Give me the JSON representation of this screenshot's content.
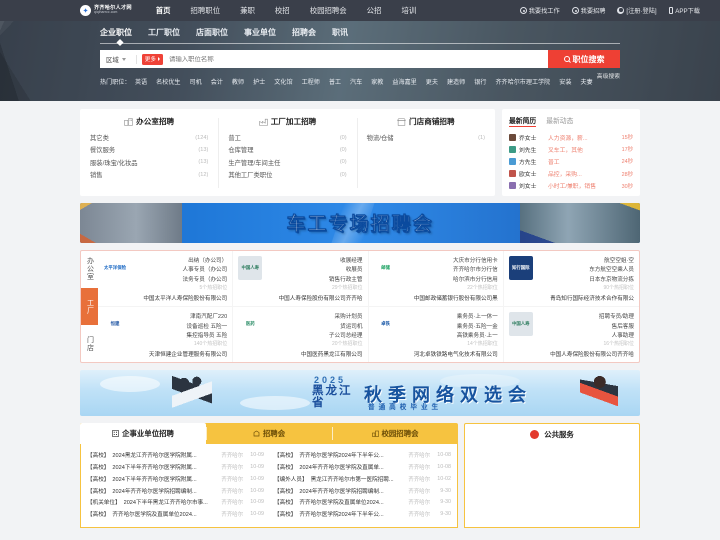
{
  "site": {
    "logo_cn": "齐齐哈尔人才网",
    "logo_en": "qiqiharrcc.com",
    "logo_glyph": "✦"
  },
  "topnav": {
    "items": [
      {
        "label": "首页",
        "active": true
      },
      {
        "label": "招聘职位",
        "active": false
      },
      {
        "label": "兼职",
        "active": false
      },
      {
        "label": "校招",
        "active": false
      },
      {
        "label": "校园招聘会",
        "active": false
      },
      {
        "label": "公招",
        "active": false
      },
      {
        "label": "培训",
        "active": false
      }
    ],
    "right": [
      {
        "label": "我要找工作",
        "icon": "compass-icon"
      },
      {
        "label": "我要招聘",
        "icon": "compass-icon"
      },
      {
        "label": "[注册·登陆]",
        "icon": "user-icon"
      },
      {
        "label": "APP下载",
        "icon": "phone-icon"
      }
    ]
  },
  "subnav": {
    "items": [
      {
        "label": "企业职位",
        "active": true
      },
      {
        "label": "工厂职位",
        "active": false
      },
      {
        "label": "店面职位",
        "active": false
      },
      {
        "label": "事业单位",
        "active": false
      },
      {
        "label": "招聘会",
        "active": false
      },
      {
        "label": "职讯",
        "active": false
      }
    ]
  },
  "search": {
    "region_label": "区域",
    "more_label": "更多",
    "placeholder": "请输入职位名称",
    "button_label": "职位搜索",
    "advanced_label": "高级搜索"
  },
  "hot": {
    "label": "热门职位：",
    "tags": [
      "英语",
      "名校优生",
      "司机",
      "会计",
      "教师",
      "护士",
      "文化馆",
      "工程师",
      "普工",
      "汽车",
      "家教",
      "益海嘉里",
      "更夫",
      "建造师",
      "银行",
      "齐齐哈尔市理工学院",
      "安装",
      "夫妻"
    ]
  },
  "categories": [
    {
      "title": "办公室招聘",
      "icon": "office-building-icon",
      "items": [
        {
          "name": "其它类",
          "count": "(124)"
        },
        {
          "name": "餐饮服务",
          "count": "(13)"
        },
        {
          "name": "服装/珠宝/化妆品",
          "count": "(13)"
        },
        {
          "name": "销售",
          "count": "(12)"
        }
      ]
    },
    {
      "title": "工厂加工招聘",
      "icon": "factory-icon",
      "items": [
        {
          "name": "普工",
          "count": "(0)"
        },
        {
          "name": "仓库管理",
          "count": "(0)"
        },
        {
          "name": "生产管理/车间主任",
          "count": "(0)"
        },
        {
          "name": "其他工厂类职位",
          "count": "(0)"
        }
      ]
    },
    {
      "title": "门店商铺招聘",
      "icon": "shop-icon",
      "items": [
        {
          "name": "物流/仓储",
          "count": "(1)"
        }
      ]
    }
  ],
  "news_panel": {
    "tabs": [
      {
        "label": "最新简历",
        "active": true
      },
      {
        "label": "最新动态",
        "active": false
      }
    ],
    "rows": [
      {
        "name": "乔女士",
        "job": "人力资源，薪...",
        "time": "15秒",
        "color": "#6b4a3a"
      },
      {
        "name": "刘先生",
        "job": "叉车工，其他",
        "time": "17秒",
        "color": "#3c9b86"
      },
      {
        "name": "方先生",
        "job": "普工",
        "time": "24秒",
        "color": "#4a9bd4"
      },
      {
        "name": "欧女士",
        "job": "品控，采购...",
        "time": "28秒",
        "color": "#c0534a"
      },
      {
        "name": "刘女士",
        "job": "小时工/兼职，销售",
        "time": "30秒",
        "color": "#8a6fb0"
      }
    ]
  },
  "banner1": {
    "title": "车工专场招聘会"
  },
  "company_grid": {
    "vtabs": [
      {
        "label": "办公室",
        "active": false
      },
      {
        "label": "工厂",
        "active": true
      },
      {
        "label": "门店",
        "active": false
      }
    ],
    "cells": [
      {
        "logo_text": "太平洋保险",
        "logo_bg": "#ffffff",
        "logo_fg": "#1a68c4",
        "jobs": [
          "出纳（办公司）",
          "人事专员（办公司",
          "法务专员（办公司"
        ],
        "count": "5个热招职位",
        "company": "中国太平洋人寿保险股份有限公司"
      },
      {
        "logo_text": "中国人寿",
        "logo_bg": "#dfe5ea",
        "logo_fg": "#2e7d5f",
        "jobs": [
          "收展经理",
          "收展员",
          "销售行政主管"
        ],
        "count": "29个热招职位",
        "company": "中国人寿保险股份有限公司齐齐哈"
      },
      {
        "logo_text": "邮储",
        "logo_bg": "#ffffff",
        "logo_fg": "#17a05e",
        "jobs": [
          "大庆市分行信用卡",
          "齐齐哈尔市分行信",
          "哈尔滨市分行信用"
        ],
        "count": "22个热招职位",
        "company": "中国邮政储蓄银行股份有限公司黑"
      },
      {
        "logo_text": "知行国际",
        "logo_bg": "#1b3f7a",
        "logo_fg": "#ffffff",
        "jobs": [
          "航空空姐·空",
          "东方航空空乘人员",
          "日本东京物流分拣"
        ],
        "count": "90个热招职位",
        "company": "青岛知行国际经济技术合作有限公"
      },
      {
        "logo_text": "恒建",
        "logo_bg": "#ffffff",
        "logo_fg": "#2b5ea8",
        "jobs": [
          "津南汽配厂220",
          "设备巡检 五险一",
          "集控指导员 五险"
        ],
        "count": "140个热招职位",
        "company": "天津恒建企业管理服务有限公司"
      },
      {
        "logo_text": "医药",
        "logo_bg": "#ffffff",
        "logo_fg": "#2f8f6a",
        "jobs": [
          "采购计划员",
          "货运司机",
          "子公司总经理"
        ],
        "count": "20个热招职位",
        "company": "中国医药黑龙江有限公司"
      },
      {
        "logo_text": "卓铁",
        "logo_bg": "#ffffff",
        "logo_fg": "#1c5aa8",
        "jobs": [
          "乘务员·上一休一",
          "乘务员·五险一金",
          "高铁乘务员·上一"
        ],
        "count": "14个热招职位",
        "company": "河北卓铁铁路电气化技术有限公司"
      },
      {
        "logo_text": "中国人寿",
        "logo_bg": "#dfe5ea",
        "logo_fg": "#2e7d5f",
        "jobs": [
          "招聘专员/助理",
          "售后客服",
          "人事助理"
        ],
        "count": "16个热招职位",
        "company": "中国人寿保险股份有限公司齐齐哈"
      }
    ]
  },
  "banner2": {
    "year": "2025",
    "province": "黑龙江省",
    "main_title": "秋季网络双选会",
    "subtitle": "普通高校毕业生"
  },
  "bottom": {
    "tabs": [
      {
        "label": "企事业单位招聘",
        "icon": "building-icon",
        "active": true
      },
      {
        "label": "招聘会",
        "icon": "fair-icon",
        "active": false
      },
      {
        "label": "校园招聘会",
        "icon": "campus-icon",
        "active": false
      }
    ],
    "right_tab": {
      "label": "公共服务",
      "icon": "seal-icon"
    },
    "list_left": [
      {
        "tag": "【高校】",
        "title": "2024黑龙江齐齐哈尔医学院附属...",
        "loc": "齐齐哈尔",
        "date": "10-09"
      },
      {
        "tag": "【高校】",
        "title": "2024下半年齐齐哈尔医学院附属...",
        "loc": "齐齐哈尔",
        "date": "10-09"
      },
      {
        "tag": "【高校】",
        "title": "2024下半年齐齐哈尔医学院附属...",
        "loc": "齐齐哈尔",
        "date": "10-09"
      },
      {
        "tag": "【高校】",
        "title": "2024年齐齐哈尔医学院招聘编制...",
        "loc": "齐齐哈尔",
        "date": "10-09"
      },
      {
        "tag": "【机关单位】",
        "title": "2024下半年黑龙江齐齐哈尔市事...",
        "loc": "齐齐哈尔",
        "date": "10-09"
      },
      {
        "tag": "【高校】",
        "title": "齐齐哈尔医学院及直属单位2024...",
        "loc": "齐齐哈尔",
        "date": "10-09"
      }
    ],
    "list_right": [
      {
        "tag": "【高校】",
        "title": "齐齐哈尔医学院2024年下半年公...",
        "loc": "齐齐哈尔",
        "date": "10-08"
      },
      {
        "tag": "【高校】",
        "title": "2024年齐齐哈尔医学院及直属单...",
        "loc": "齐齐哈尔",
        "date": "10-08"
      },
      {
        "tag": "【编外人员】",
        "title": "黑龙江齐齐哈尔市第一医院招聘...",
        "loc": "齐齐哈尔",
        "date": "10-02"
      },
      {
        "tag": "【高校】",
        "title": "2024年齐齐哈尔医学院招聘编制...",
        "loc": "齐齐哈尔",
        "date": "9-30"
      },
      {
        "tag": "【高校】",
        "title": "齐齐哈尔医学院及直属单位2024...",
        "loc": "齐齐哈尔",
        "date": "9-30"
      },
      {
        "tag": "【高校】",
        "title": "齐齐哈尔医学院2024年下半年公...",
        "loc": "齐齐哈尔",
        "date": "9-30"
      }
    ]
  }
}
